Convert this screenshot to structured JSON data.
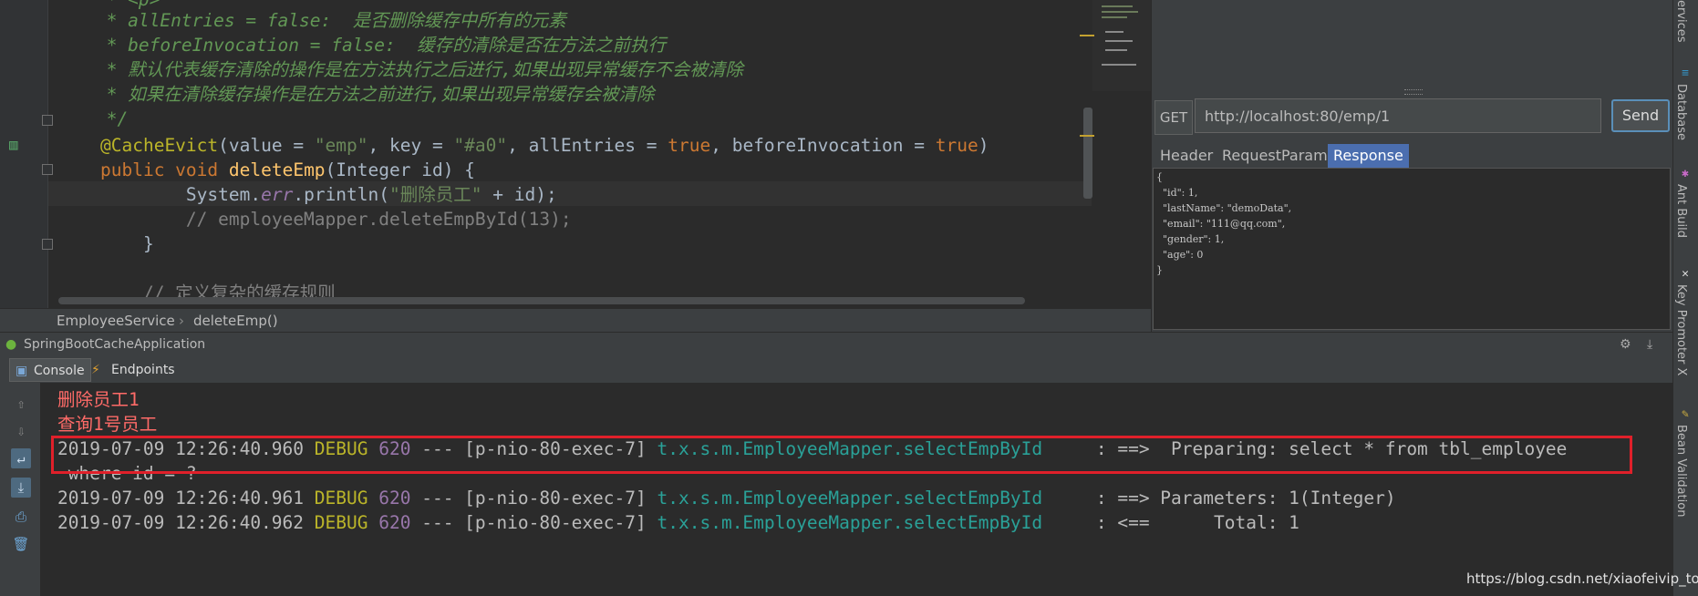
{
  "editor": {
    "comment_lines": [
      "     * allEntries = false:  是否删除缓存中所有的元素",
      "     * beforeInvocation = false:  缓存的清除是否在方法之前执行",
      "     * 默认代表缓存清除的操作是在方法执行之后进行,如果出现异常缓存不会被清除",
      "     * 如果在清除缓存操作是在方法之前进行,如果出现异常缓存会被清除",
      "     */"
    ],
    "annotation": {
      "name": "@CacheEvict",
      "p1": "(value = ",
      "v1": "\"emp\"",
      "p2": ", key = ",
      "v2": "\"#a0\"",
      "p3": ", allEntries = ",
      "v3": "true",
      "p4": ", beforeInvocation = ",
      "v4": "true",
      "p5": ")"
    },
    "method_decl": {
      "kw": "public void ",
      "name": "deleteEmp",
      "params": "(Integer id) {"
    },
    "println": {
      "a": "        System.",
      "err": "err",
      "b": ".println(",
      "str": "\"删除员工\"",
      "c": " + id);"
    },
    "commented_call": "        // employeeMapper.deleteEmpById(13);",
    "close_brace": "    }",
    "next_comment": "    // 定义复杂的缓存规则",
    "top_partial": "     * <p>"
  },
  "breadcrumb": {
    "class_name": "EmployeeService",
    "separator": "›",
    "method_name": "deleteEmp()"
  },
  "rest_client": {
    "method": "GET",
    "url": "http://localhost:80/emp/1",
    "send_label": "Send",
    "tabs": [
      "Header",
      "RequestParams",
      "Response"
    ],
    "active_tab": "Response",
    "response_lines": [
      "{",
      "  \"id\": 1,",
      "  \"lastName\": \"demoData\",",
      "  \"email\": \"111@qq.com\",",
      "  \"gender\": 1,",
      "  \"age\": 0",
      "}"
    ]
  },
  "right_strip": {
    "items": [
      "ervices",
      "Database",
      "Ant Build",
      "Key Promoter X",
      "Bean Validation"
    ]
  },
  "run_panel": {
    "app_name": "SpringBootCacheApplication",
    "tabs": [
      "Console",
      "Endpoints"
    ],
    "active_tab": "Console",
    "output": {
      "line1": "删除员工1",
      "line2": "查询1号员工",
      "log": [
        {
          "ts": "2019-07-09 12:26:40.960",
          "level": "DEBUG",
          "pid": "620",
          "thread": "--- [p-nio-80-exec-7]",
          "logger": "t.x.s.m.EmployeeMapper.selectEmpById",
          "msg": "     : ==>  Preparing: select * from tbl_employee"
        },
        {
          "ts": "2019-07-09 12:26:40.961",
          "level": "DEBUG",
          "pid": "620",
          "thread": "--- [p-nio-80-exec-7]",
          "logger": "t.x.s.m.EmployeeMapper.selectEmpById",
          "msg": "     : ==> Parameters: 1(Integer)"
        },
        {
          "ts": "2019-07-09 12:26:40.962",
          "level": "DEBUG",
          "pid": "620",
          "thread": "--- [p-nio-80-exec-7]",
          "logger": "t.x.s.m.EmployeeMapper.selectEmpById",
          "msg": "     : <==      Total: 1"
        }
      ],
      "wrap_line": " where id = ?"
    }
  },
  "watermark": "https://blog.csdn.net/xiaofeivip_top",
  "colors": {
    "editor_bg": "#2b2b2b",
    "panel_bg": "#3c3f41",
    "comment": "#629755",
    "keyword": "#cc7832",
    "string": "#6a8759",
    "annotation": "#bbb529",
    "method": "#ffc66d",
    "console_red": "#ff6b68",
    "logger_cyan": "#2aa198",
    "highlight_box": "#e0202a",
    "active_tab": "#4b6eaf"
  }
}
